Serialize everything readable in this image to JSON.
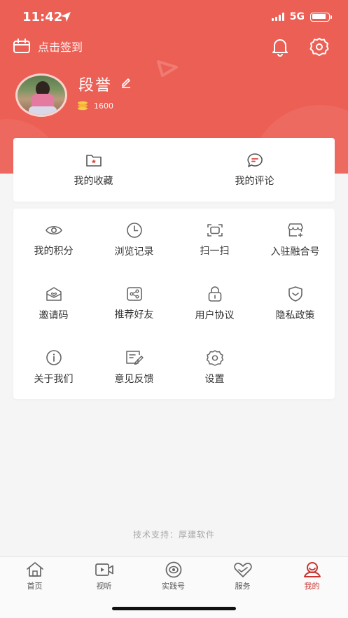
{
  "status": {
    "time": "11:42",
    "network": "5G"
  },
  "header": {
    "checkin_label": "点击签到",
    "username": "段誉",
    "coins": "1600"
  },
  "favorites": [
    {
      "label": "我的收藏",
      "icon": "folder-star-icon"
    },
    {
      "label": "我的评论",
      "icon": "comment-icon"
    }
  ],
  "grid": [
    {
      "label": "我的积分",
      "icon": "eye-icon"
    },
    {
      "label": "浏览记录",
      "icon": "clock-icon"
    },
    {
      "label": "扫一扫",
      "icon": "scan-icon"
    },
    {
      "label": "入驻融合号",
      "icon": "store-icon"
    },
    {
      "label": "邀请码",
      "icon": "envelope-heart-icon"
    },
    {
      "label": "推荐好友",
      "icon": "share-icon"
    },
    {
      "label": "用户协议",
      "icon": "lock-icon"
    },
    {
      "label": "隐私政策",
      "icon": "shield-icon"
    },
    {
      "label": "关于我们",
      "icon": "info-icon"
    },
    {
      "label": "意见反馈",
      "icon": "feedback-icon"
    },
    {
      "label": "设置",
      "icon": "gear-icon"
    }
  ],
  "footer_note": "技术支持：厚建软件",
  "tabs": [
    {
      "label": "首页",
      "icon": "home-icon"
    },
    {
      "label": "视听",
      "icon": "video-icon"
    },
    {
      "label": "实践号",
      "icon": "target-icon"
    },
    {
      "label": "服务",
      "icon": "heart-hand-icon"
    },
    {
      "label": "我的",
      "icon": "user-icon",
      "active": true
    }
  ],
  "colors": {
    "brand": "#ec5f55",
    "active_tab": "#c8342f",
    "icon": "#666666"
  }
}
